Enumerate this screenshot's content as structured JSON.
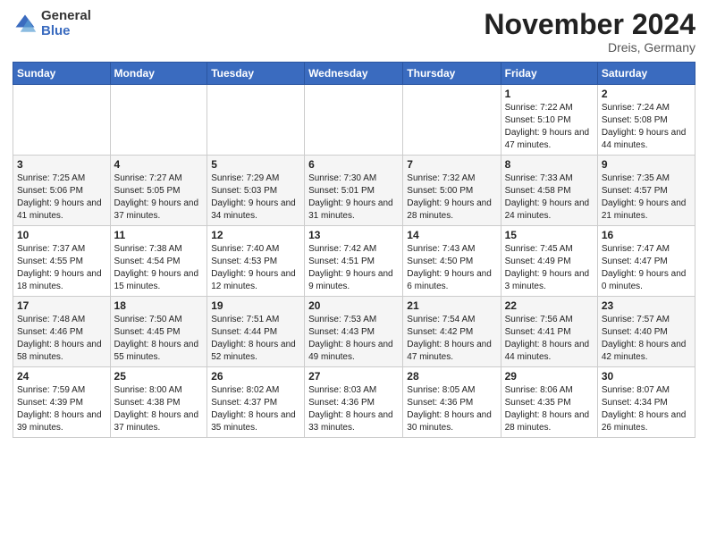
{
  "logo": {
    "general": "General",
    "blue": "Blue"
  },
  "header": {
    "month": "November 2024",
    "location": "Dreis, Germany"
  },
  "weekdays": [
    "Sunday",
    "Monday",
    "Tuesday",
    "Wednesday",
    "Thursday",
    "Friday",
    "Saturday"
  ],
  "weeks": [
    [
      {
        "day": "",
        "info": ""
      },
      {
        "day": "",
        "info": ""
      },
      {
        "day": "",
        "info": ""
      },
      {
        "day": "",
        "info": ""
      },
      {
        "day": "",
        "info": ""
      },
      {
        "day": "1",
        "info": "Sunrise: 7:22 AM\nSunset: 5:10 PM\nDaylight: 9 hours and 47 minutes."
      },
      {
        "day": "2",
        "info": "Sunrise: 7:24 AM\nSunset: 5:08 PM\nDaylight: 9 hours and 44 minutes."
      }
    ],
    [
      {
        "day": "3",
        "info": "Sunrise: 7:25 AM\nSunset: 5:06 PM\nDaylight: 9 hours and 41 minutes."
      },
      {
        "day": "4",
        "info": "Sunrise: 7:27 AM\nSunset: 5:05 PM\nDaylight: 9 hours and 37 minutes."
      },
      {
        "day": "5",
        "info": "Sunrise: 7:29 AM\nSunset: 5:03 PM\nDaylight: 9 hours and 34 minutes."
      },
      {
        "day": "6",
        "info": "Sunrise: 7:30 AM\nSunset: 5:01 PM\nDaylight: 9 hours and 31 minutes."
      },
      {
        "day": "7",
        "info": "Sunrise: 7:32 AM\nSunset: 5:00 PM\nDaylight: 9 hours and 28 minutes."
      },
      {
        "day": "8",
        "info": "Sunrise: 7:33 AM\nSunset: 4:58 PM\nDaylight: 9 hours and 24 minutes."
      },
      {
        "day": "9",
        "info": "Sunrise: 7:35 AM\nSunset: 4:57 PM\nDaylight: 9 hours and 21 minutes."
      }
    ],
    [
      {
        "day": "10",
        "info": "Sunrise: 7:37 AM\nSunset: 4:55 PM\nDaylight: 9 hours and 18 minutes."
      },
      {
        "day": "11",
        "info": "Sunrise: 7:38 AM\nSunset: 4:54 PM\nDaylight: 9 hours and 15 minutes."
      },
      {
        "day": "12",
        "info": "Sunrise: 7:40 AM\nSunset: 4:53 PM\nDaylight: 9 hours and 12 minutes."
      },
      {
        "day": "13",
        "info": "Sunrise: 7:42 AM\nSunset: 4:51 PM\nDaylight: 9 hours and 9 minutes."
      },
      {
        "day": "14",
        "info": "Sunrise: 7:43 AM\nSunset: 4:50 PM\nDaylight: 9 hours and 6 minutes."
      },
      {
        "day": "15",
        "info": "Sunrise: 7:45 AM\nSunset: 4:49 PM\nDaylight: 9 hours and 3 minutes."
      },
      {
        "day": "16",
        "info": "Sunrise: 7:47 AM\nSunset: 4:47 PM\nDaylight: 9 hours and 0 minutes."
      }
    ],
    [
      {
        "day": "17",
        "info": "Sunrise: 7:48 AM\nSunset: 4:46 PM\nDaylight: 8 hours and 58 minutes."
      },
      {
        "day": "18",
        "info": "Sunrise: 7:50 AM\nSunset: 4:45 PM\nDaylight: 8 hours and 55 minutes."
      },
      {
        "day": "19",
        "info": "Sunrise: 7:51 AM\nSunset: 4:44 PM\nDaylight: 8 hours and 52 minutes."
      },
      {
        "day": "20",
        "info": "Sunrise: 7:53 AM\nSunset: 4:43 PM\nDaylight: 8 hours and 49 minutes."
      },
      {
        "day": "21",
        "info": "Sunrise: 7:54 AM\nSunset: 4:42 PM\nDaylight: 8 hours and 47 minutes."
      },
      {
        "day": "22",
        "info": "Sunrise: 7:56 AM\nSunset: 4:41 PM\nDaylight: 8 hours and 44 minutes."
      },
      {
        "day": "23",
        "info": "Sunrise: 7:57 AM\nSunset: 4:40 PM\nDaylight: 8 hours and 42 minutes."
      }
    ],
    [
      {
        "day": "24",
        "info": "Sunrise: 7:59 AM\nSunset: 4:39 PM\nDaylight: 8 hours and 39 minutes."
      },
      {
        "day": "25",
        "info": "Sunrise: 8:00 AM\nSunset: 4:38 PM\nDaylight: 8 hours and 37 minutes."
      },
      {
        "day": "26",
        "info": "Sunrise: 8:02 AM\nSunset: 4:37 PM\nDaylight: 8 hours and 35 minutes."
      },
      {
        "day": "27",
        "info": "Sunrise: 8:03 AM\nSunset: 4:36 PM\nDaylight: 8 hours and 33 minutes."
      },
      {
        "day": "28",
        "info": "Sunrise: 8:05 AM\nSunset: 4:36 PM\nDaylight: 8 hours and 30 minutes."
      },
      {
        "day": "29",
        "info": "Sunrise: 8:06 AM\nSunset: 4:35 PM\nDaylight: 8 hours and 28 minutes."
      },
      {
        "day": "30",
        "info": "Sunrise: 8:07 AM\nSunset: 4:34 PM\nDaylight: 8 hours and 26 minutes."
      }
    ]
  ]
}
